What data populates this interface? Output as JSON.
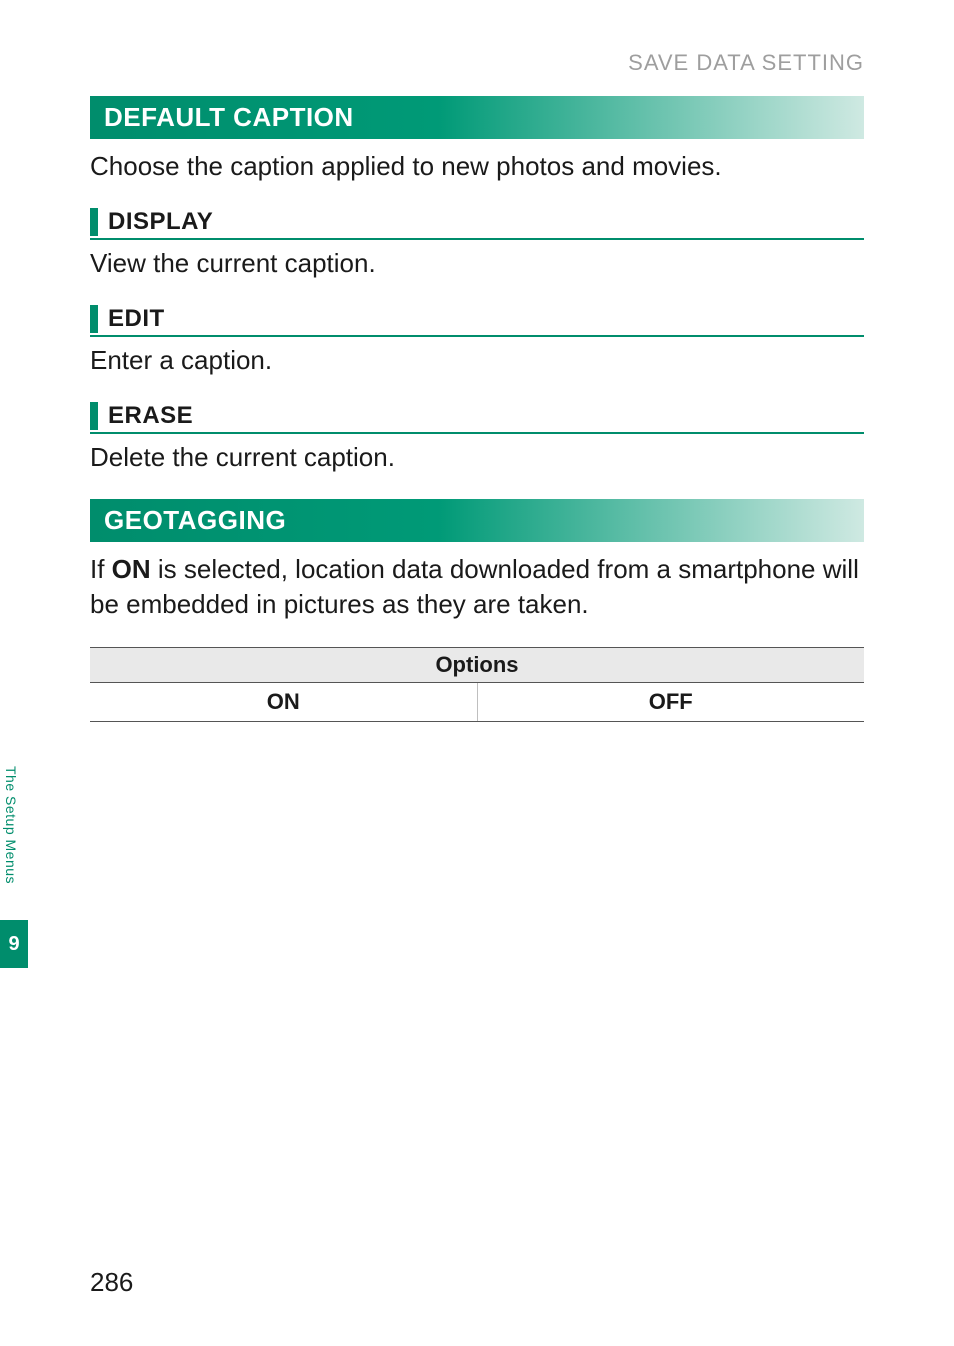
{
  "header": {
    "running_title": "SAVE DATA SETTING"
  },
  "sections": {
    "default_caption": {
      "title": "DEFAULT CAPTION",
      "intro": "Choose the caption applied to new photos and movies.",
      "display": {
        "title": "DISPLAY",
        "text": "View the current caption."
      },
      "edit": {
        "title": "EDIT",
        "text": "Enter a caption."
      },
      "erase": {
        "title": "ERASE",
        "text": "Delete the current caption."
      }
    },
    "geotagging": {
      "title": "GEOTAGGING",
      "intro_prefix": "If ",
      "intro_bold": "ON",
      "intro_suffix": " is selected, location data downloaded from a smartphone will be embedded in pictures as they are taken.",
      "options_header": "Options",
      "options": [
        "ON",
        "OFF"
      ]
    }
  },
  "sidebar": {
    "tab_label": "The Setup Menus",
    "chapter_number": "9"
  },
  "footer": {
    "page_number": "286"
  }
}
